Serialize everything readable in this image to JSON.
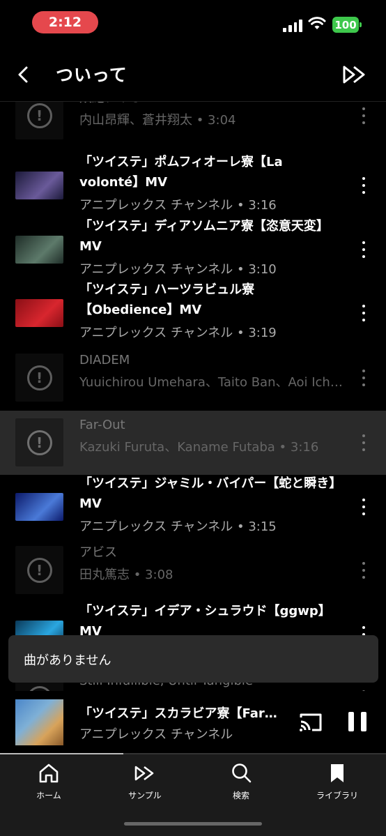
{
  "status_bar": {
    "time": "2:12",
    "battery": "100",
    "time_pill_color": "#e5484d",
    "battery_color": "#3ec84c"
  },
  "header": {
    "title": "ついって"
  },
  "tracks": [
    {
      "title": "双絶アイオーン",
      "subtitle": "内山昂輝、蒼井翔太 • 3:04",
      "available": false,
      "thumb_colors": [
        "#141414"
      ]
    },
    {
      "title": "「ツイステ」ポムフィオーレ寮【La volonté】MV",
      "subtitle": "アニプレックス チャンネル • 3:16",
      "available": true,
      "thumb_colors": [
        "#1c1a3a",
        "#6a5a9a"
      ]
    },
    {
      "title": "「ツイステ」ディアソムニア寮【恣意天変】MV",
      "subtitle": "アニプレックス チャンネル • 3:10",
      "available": true,
      "thumb_colors": [
        "#1f2d28",
        "#5d7a6a"
      ]
    },
    {
      "title": "「ツイステ」ハーツラビュル寮【Obedience】MV",
      "subtitle": "アニプレックス チャンネル • 3:19",
      "available": true,
      "thumb_colors": [
        "#8a0f16",
        "#d8262e"
      ]
    },
    {
      "title": "DIADEM",
      "subtitle": "Yuuichirou Umehara、Taito Ban、Aoi Ichikawa",
      "available": false,
      "thumb_colors": [
        "#141414"
      ]
    },
    {
      "title": "Far-Out",
      "subtitle": "Kazuki Furuta、Kaname Futaba • 3:16",
      "available": false,
      "highlighted": true,
      "thumb_colors": [
        "#141414"
      ]
    },
    {
      "title": "「ツイステ」ジャミル・バイパー【蛇と瞬き】MV",
      "subtitle": "アニプレックス チャンネル • 3:15",
      "available": true,
      "thumb_colors": [
        "#0c1a6a",
        "#4a7ad8"
      ]
    },
    {
      "title": "アビス",
      "subtitle": "田丸篤志 • 3:08",
      "available": false,
      "thumb_colors": [
        "#141414"
      ]
    },
    {
      "title": "「ツイステ」イデア・シュラウド【ggwp】MV",
      "subtitle": "",
      "available": true,
      "thumb_colors": [
        "#0a3a5a",
        "#2aa6e0"
      ]
    },
    {
      "title": "Still Infallible, Until Tangible",
      "subtitle": "",
      "available": false,
      "thumb_colors": [
        "#141414"
      ]
    }
  ],
  "toast": {
    "message": "曲がありません"
  },
  "mini_player": {
    "title": "「ツイステ」スカラビア寮【Far-Out】MV",
    "subtitle": "アニプレックス チャンネル",
    "progress": 0.32
  },
  "nav": {
    "items": [
      {
        "label": "ホーム",
        "icon": "home-icon"
      },
      {
        "label": "サンプル",
        "icon": "samples-icon"
      },
      {
        "label": "検索",
        "icon": "search-icon"
      },
      {
        "label": "ライブラリ",
        "icon": "library-icon"
      }
    ]
  }
}
